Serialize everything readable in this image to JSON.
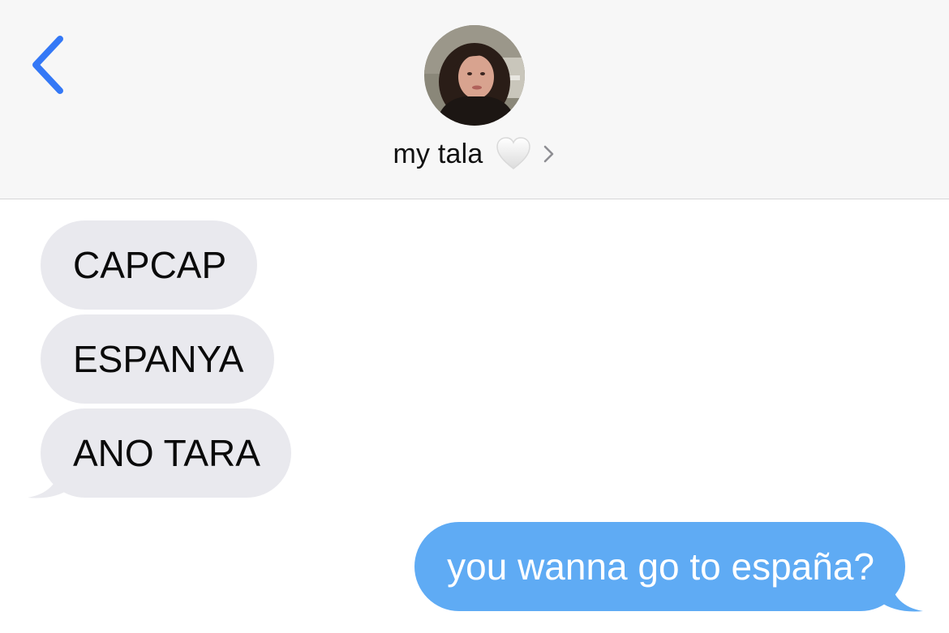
{
  "header": {
    "contact_name": "my tala",
    "icons": {
      "back": "chevron-left-icon",
      "heart": "white-heart-icon",
      "details": "chevron-right-icon"
    }
  },
  "messages": [
    {
      "direction": "incoming",
      "text": "CAPCAP"
    },
    {
      "direction": "incoming",
      "text": "ESPANYA"
    },
    {
      "direction": "incoming",
      "text": "ANO TARA"
    },
    {
      "direction": "outgoing",
      "text": "you wanna go to españa?"
    }
  ],
  "colors": {
    "accent": "#3478f6",
    "header_bg": "#f7f7f7",
    "incoming_bubble": "#e9e9ee",
    "outgoing_bubble": "#5fabf4"
  }
}
